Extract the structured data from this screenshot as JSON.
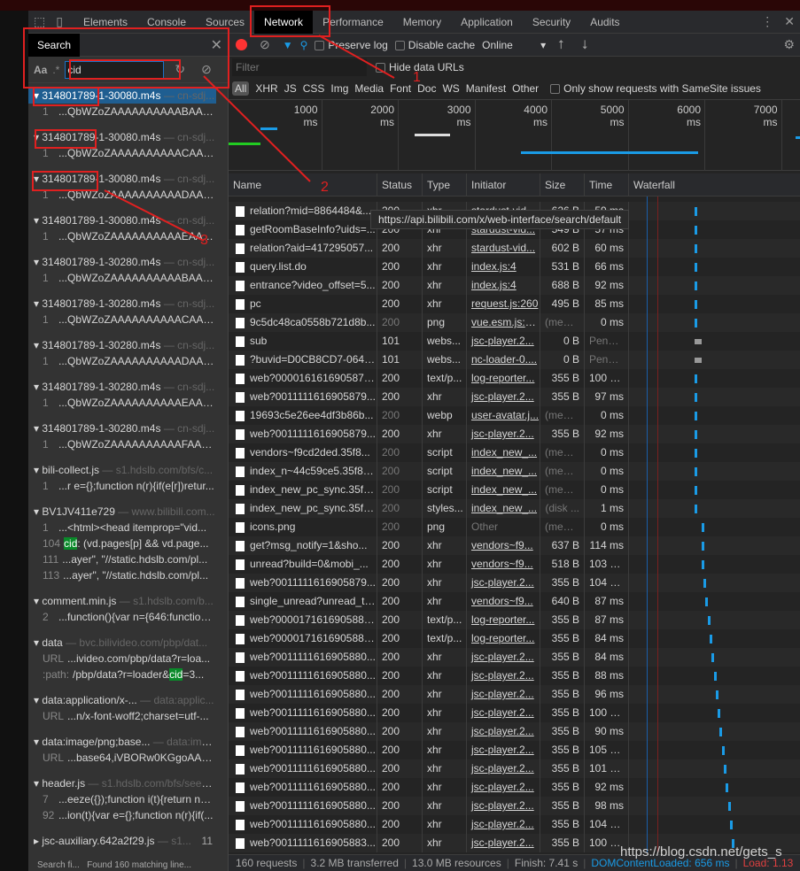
{
  "tabs": {
    "items": [
      "Elements",
      "Console",
      "Sources",
      "Network",
      "Performance",
      "Memory",
      "Application",
      "Security",
      "Audits"
    ],
    "active": "Network"
  },
  "search": {
    "title": "Search",
    "case_label": "Aa",
    "regex_label": ".*",
    "query": "cid",
    "groups": [
      {
        "file": "314801789-1-30080.m4s",
        "source": "— cn-sdj...",
        "selected": true,
        "lines": [
          {
            "n": "1",
            "text": "...QbWZoZAAAAAAAAAABAAAE..."
          }
        ]
      },
      {
        "file": "314801789-1-30080.m4s",
        "source": "— cn-sdj...",
        "lines": [
          {
            "n": "1",
            "text": "...QbWZoZAAAAAAAAAACAAAE..."
          }
        ]
      },
      {
        "file": "314801789-1-30080.m4s",
        "source": "— cn-sdj...",
        "lines": [
          {
            "n": "1",
            "text": "...QbWZoZAAAAAAAAAADAAA..."
          }
        ]
      },
      {
        "file": "314801789-1-30080.m4s",
        "source": "— cn-sdj...",
        "lines": [
          {
            "n": "1",
            "text": "...QbWZoZAAAAAAAAAAEAAAE..."
          }
        ]
      },
      {
        "file": "314801789-1-30280.m4s",
        "source": "— cn-sdj...",
        "lines": [
          {
            "n": "1",
            "text": "...QbWZoZAAAAAAAAAABAAA..."
          }
        ]
      },
      {
        "file": "314801789-1-30280.m4s",
        "source": "— cn-sdj...",
        "lines": [
          {
            "n": "1",
            "text": "...QbWZoZAAAAAAAAAACAAA..."
          }
        ]
      },
      {
        "file": "314801789-1-30280.m4s",
        "source": "— cn-sdj...",
        "lines": [
          {
            "n": "1",
            "text": "...QbWZoZAAAAAAAAAADAAA..."
          }
        ]
      },
      {
        "file": "314801789-1-30280.m4s",
        "source": "— cn-sdj...",
        "lines": [
          {
            "n": "1",
            "text": "...QbWZoZAAAAAAAAAAEAAA..."
          }
        ]
      },
      {
        "file": "314801789-1-30280.m4s",
        "source": "— cn-sdj...",
        "lines": [
          {
            "n": "1",
            "text": "...QbWZoZAAAAAAAAAAFAAA..."
          }
        ]
      },
      {
        "file": "bili-collect.js",
        "source": "— s1.hdslb.com/bfs/c...",
        "lines": [
          {
            "n": "1",
            "text": "...r e={};function n(r){if(e[r])retur..."
          }
        ]
      },
      {
        "file": "BV1JV411e729",
        "source": "— www.bilibili.com...",
        "lines": [
          {
            "n": "1",
            "text": "...<html><head itemprop=\"vid..."
          },
          {
            "n": "104",
            "pre": "",
            "match": "cid",
            "text": ": (vd.pages[p] && vd.page..."
          },
          {
            "n": "111",
            "text": "...ayer\", \"//static.hdslb.com/pl..."
          },
          {
            "n": "113",
            "text": "...ayer\", \"//static.hdslb.com/pl..."
          }
        ]
      },
      {
        "file": "comment.min.js",
        "source": "— s1.hdslb.com/b...",
        "lines": [
          {
            "n": "2",
            "text": "...function(){var n={646:function(..."
          }
        ]
      },
      {
        "file": "data",
        "source": "— bvc.bilivideo.com/pbp/dat...",
        "lines": [
          {
            "n": "URL",
            "text": "...ivideo.com/pbp/data?r=loa..."
          },
          {
            "n": ":path:",
            "pre": "/pbp/data?r=loader&",
            "match": "cid",
            "text": "=3..."
          }
        ]
      },
      {
        "file": "data:application/x-...",
        "source": "— data:applic...",
        "lines": [
          {
            "n": "URL",
            "text": "...n/x-font-woff2;charset=utf-..."
          }
        ]
      },
      {
        "file": "data:image/png;base...",
        "source": "— data:ima...",
        "lines": [
          {
            "n": "URL",
            "text": "...base64,iVBORw0KGgoAAA..."
          }
        ]
      },
      {
        "file": "header.js",
        "source": "— s1.hdslb.com/bfs/seed...",
        "lines": [
          {
            "n": "7",
            "text": "...eeze({});function i(t){return null..."
          },
          {
            "n": "92",
            "text": "...ion(t){var e={};function n(r){if(..."
          }
        ]
      },
      {
        "file": "jsc-auxiliary.642a2f29.js",
        "source": "— s1...",
        "count": "11",
        "collapsed": true,
        "lines": []
      }
    ],
    "status_left": "Search fi...",
    "status_right": "Found 160 matching line..."
  },
  "network": {
    "toolbar": {
      "preserve_log": "Preserve log",
      "disable_cache": "Disable cache",
      "throttle": "Online"
    },
    "filter_placeholder": "Filter",
    "hide_data_urls": "Hide data URLs",
    "types": [
      "All",
      "XHR",
      "JS",
      "CSS",
      "Img",
      "Media",
      "Font",
      "Doc",
      "WS",
      "Manifest",
      "Other"
    ],
    "samesite": "Only show requests with SameSite issues",
    "overview_ticks": [
      "1000 ms",
      "2000 ms",
      "3000 ms",
      "4000 ms",
      "5000 ms",
      "6000 ms",
      "7000 ms"
    ],
    "columns": [
      "Name",
      "Status",
      "Type",
      "Initiator",
      "Size",
      "Time",
      "Waterfall"
    ],
    "tooltip": "https://api.bilibili.com/x/web-interface/search/default",
    "rows": [
      {
        "name": "relation?mid=8864484&...",
        "status": "200",
        "type": "xhr",
        "initiator": "stardust-vid...",
        "size": "626 B",
        "time": "59 ms"
      },
      {
        "name": "getRoomBaseInfo?uids=...",
        "status": "200",
        "type": "xhr",
        "initiator": "stardust-vid...",
        "size": "549 B",
        "time": "57 ms"
      },
      {
        "name": "relation?aid=417295057...",
        "status": "200",
        "type": "xhr",
        "initiator": "stardust-vid...",
        "size": "602 B",
        "time": "60 ms"
      },
      {
        "name": "query.list.do",
        "status": "200",
        "type": "xhr",
        "initiator": "index.js:4",
        "size": "531 B",
        "time": "66 ms"
      },
      {
        "name": "entrance?video_offset=5...",
        "status": "200",
        "type": "xhr",
        "initiator": "index.js:4",
        "size": "688 B",
        "time": "92 ms"
      },
      {
        "name": "pc",
        "status": "200",
        "type": "xhr",
        "initiator": "request.js:260",
        "size": "495 B",
        "time": "85 ms"
      },
      {
        "name": "9c5dc48ca0558b721d8b...",
        "status": "200",
        "type": "png",
        "initiator": "vue.esm.js:6...",
        "size": "(mem...",
        "time": "0 ms",
        "cached": true
      },
      {
        "name": "sub",
        "status": "101",
        "type": "webs...",
        "initiator": "jsc-player.2...",
        "size": "0 B",
        "time": "Pendi...",
        "pending": true
      },
      {
        "name": "?buvid=D0CB8CD7-064F...",
        "status": "101",
        "type": "webs...",
        "initiator": "nc-loader-0....",
        "size": "0 B",
        "time": "Pendi...",
        "pending": true
      },
      {
        "name": "web?0000161616905879...",
        "status": "200",
        "type": "text/p...",
        "initiator": "log-reporter...",
        "size": "355 B",
        "time": "100 ms"
      },
      {
        "name": "web?0011111616905879...",
        "status": "200",
        "type": "xhr",
        "initiator": "jsc-player.2...",
        "size": "355 B",
        "time": "97 ms"
      },
      {
        "name": "19693c5e26ee4df3b86b...",
        "status": "200",
        "type": "webp",
        "initiator": "user-avatar.j...",
        "size": "(mem...",
        "time": "0 ms",
        "cached": true
      },
      {
        "name": "web?0011111616905879...",
        "status": "200",
        "type": "xhr",
        "initiator": "jsc-player.2...",
        "size": "355 B",
        "time": "92 ms"
      },
      {
        "name": "vendors~f9cd2ded.35f8...",
        "status": "200",
        "type": "script",
        "initiator": "index_new_...",
        "size": "(mem...",
        "time": "0 ms",
        "cached": true
      },
      {
        "name": "index_n~44c59ce5.35f8a...",
        "status": "200",
        "type": "script",
        "initiator": "index_new_...",
        "size": "(mem...",
        "time": "0 ms",
        "cached": true
      },
      {
        "name": "index_new_pc_sync.35f8...",
        "status": "200",
        "type": "script",
        "initiator": "index_new_...",
        "size": "(mem...",
        "time": "0 ms",
        "cached": true
      },
      {
        "name": "index_new_pc_sync.35f8...",
        "status": "200",
        "type": "styles...",
        "initiator": "index_new_...",
        "size": "(disk ...",
        "time": "1 ms",
        "cached": true
      },
      {
        "name": "icons.png",
        "status": "200",
        "type": "png",
        "initiator": "Other",
        "size": "(mem...",
        "time": "0 ms",
        "cached": true
      },
      {
        "name": "get?msg_notify=1&sho...",
        "status": "200",
        "type": "xhr",
        "initiator": "vendors~f9...",
        "size": "637 B",
        "time": "114 ms"
      },
      {
        "name": "unread?build=0&mobi_...",
        "status": "200",
        "type": "xhr",
        "initiator": "vendors~f9...",
        "size": "518 B",
        "time": "103 ms"
      },
      {
        "name": "web?0011111616905879...",
        "status": "200",
        "type": "xhr",
        "initiator": "jsc-player.2...",
        "size": "355 B",
        "time": "104 ms"
      },
      {
        "name": "single_unread?unread_ty...",
        "status": "200",
        "type": "xhr",
        "initiator": "vendors~f9...",
        "size": "640 B",
        "time": "87 ms"
      },
      {
        "name": "web?0000171616905880...",
        "status": "200",
        "type": "text/p...",
        "initiator": "log-reporter...",
        "size": "355 B",
        "time": "87 ms"
      },
      {
        "name": "web?0000171616905880...",
        "status": "200",
        "type": "text/p...",
        "initiator": "log-reporter...",
        "size": "355 B",
        "time": "84 ms"
      },
      {
        "name": "web?0011111616905880...",
        "status": "200",
        "type": "xhr",
        "initiator": "jsc-player.2...",
        "size": "355 B",
        "time": "84 ms"
      },
      {
        "name": "web?0011111616905880...",
        "status": "200",
        "type": "xhr",
        "initiator": "jsc-player.2...",
        "size": "355 B",
        "time": "88 ms"
      },
      {
        "name": "web?0011111616905880...",
        "status": "200",
        "type": "xhr",
        "initiator": "jsc-player.2...",
        "size": "355 B",
        "time": "96 ms"
      },
      {
        "name": "web?0011111616905880...",
        "status": "200",
        "type": "xhr",
        "initiator": "jsc-player.2...",
        "size": "355 B",
        "time": "100 ms"
      },
      {
        "name": "web?0011111616905880...",
        "status": "200",
        "type": "xhr",
        "initiator": "jsc-player.2...",
        "size": "355 B",
        "time": "90 ms"
      },
      {
        "name": "web?0011111616905880...",
        "status": "200",
        "type": "xhr",
        "initiator": "jsc-player.2...",
        "size": "355 B",
        "time": "105 ms"
      },
      {
        "name": "web?0011111616905880...",
        "status": "200",
        "type": "xhr",
        "initiator": "jsc-player.2...",
        "size": "355 B",
        "time": "101 ms"
      },
      {
        "name": "web?0011111616905880...",
        "status": "200",
        "type": "xhr",
        "initiator": "jsc-player.2...",
        "size": "355 B",
        "time": "92 ms"
      },
      {
        "name": "web?0011111616905880...",
        "status": "200",
        "type": "xhr",
        "initiator": "jsc-player.2...",
        "size": "355 B",
        "time": "98 ms"
      },
      {
        "name": "web?0011111616905880...",
        "status": "200",
        "type": "xhr",
        "initiator": "jsc-player.2...",
        "size": "355 B",
        "time": "104 ms"
      },
      {
        "name": "web?0011111616905883...",
        "status": "200",
        "type": "xhr",
        "initiator": "jsc-player.2...",
        "size": "355 B",
        "time": "100 ms"
      }
    ],
    "status": {
      "requests": "160 requests",
      "transferred": "3.2 MB transferred",
      "resources": "13.0 MB resources",
      "finish": "Finish: 7.41 s",
      "dcl": "DOMContentLoaded: 656 ms",
      "load": "Load: 1.13"
    }
  },
  "annotations": [
    "1",
    "2",
    "3"
  ],
  "watermark": "https://blog.csdn.net/gets_s",
  "colors": {
    "annotation": "#e02020",
    "dcl": "#1a9be6",
    "load": "#e04040",
    "selected": "#1f5e91"
  }
}
